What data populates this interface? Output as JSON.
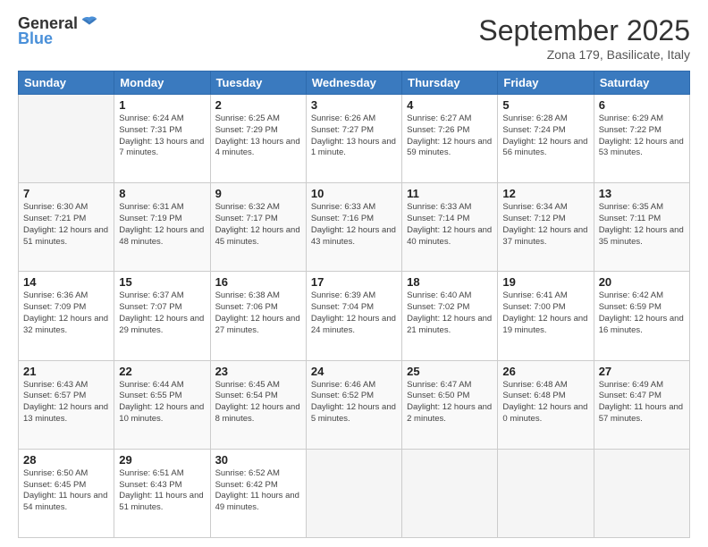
{
  "header": {
    "logo_general": "General",
    "logo_blue": "Blue",
    "month_title": "September 2025",
    "subtitle": "Zona 179, Basilicate, Italy"
  },
  "weekdays": [
    "Sunday",
    "Monday",
    "Tuesday",
    "Wednesday",
    "Thursday",
    "Friday",
    "Saturday"
  ],
  "weeks": [
    [
      {
        "day": "",
        "info": ""
      },
      {
        "day": "1",
        "info": "Sunrise: 6:24 AM\nSunset: 7:31 PM\nDaylight: 13 hours\nand 7 minutes."
      },
      {
        "day": "2",
        "info": "Sunrise: 6:25 AM\nSunset: 7:29 PM\nDaylight: 13 hours\nand 4 minutes."
      },
      {
        "day": "3",
        "info": "Sunrise: 6:26 AM\nSunset: 7:27 PM\nDaylight: 13 hours\nand 1 minute."
      },
      {
        "day": "4",
        "info": "Sunrise: 6:27 AM\nSunset: 7:26 PM\nDaylight: 12 hours\nand 59 minutes."
      },
      {
        "day": "5",
        "info": "Sunrise: 6:28 AM\nSunset: 7:24 PM\nDaylight: 12 hours\nand 56 minutes."
      },
      {
        "day": "6",
        "info": "Sunrise: 6:29 AM\nSunset: 7:22 PM\nDaylight: 12 hours\nand 53 minutes."
      }
    ],
    [
      {
        "day": "7",
        "info": "Sunrise: 6:30 AM\nSunset: 7:21 PM\nDaylight: 12 hours\nand 51 minutes."
      },
      {
        "day": "8",
        "info": "Sunrise: 6:31 AM\nSunset: 7:19 PM\nDaylight: 12 hours\nand 48 minutes."
      },
      {
        "day": "9",
        "info": "Sunrise: 6:32 AM\nSunset: 7:17 PM\nDaylight: 12 hours\nand 45 minutes."
      },
      {
        "day": "10",
        "info": "Sunrise: 6:33 AM\nSunset: 7:16 PM\nDaylight: 12 hours\nand 43 minutes."
      },
      {
        "day": "11",
        "info": "Sunrise: 6:33 AM\nSunset: 7:14 PM\nDaylight: 12 hours\nand 40 minutes."
      },
      {
        "day": "12",
        "info": "Sunrise: 6:34 AM\nSunset: 7:12 PM\nDaylight: 12 hours\nand 37 minutes."
      },
      {
        "day": "13",
        "info": "Sunrise: 6:35 AM\nSunset: 7:11 PM\nDaylight: 12 hours\nand 35 minutes."
      }
    ],
    [
      {
        "day": "14",
        "info": "Sunrise: 6:36 AM\nSunset: 7:09 PM\nDaylight: 12 hours\nand 32 minutes."
      },
      {
        "day": "15",
        "info": "Sunrise: 6:37 AM\nSunset: 7:07 PM\nDaylight: 12 hours\nand 29 minutes."
      },
      {
        "day": "16",
        "info": "Sunrise: 6:38 AM\nSunset: 7:06 PM\nDaylight: 12 hours\nand 27 minutes."
      },
      {
        "day": "17",
        "info": "Sunrise: 6:39 AM\nSunset: 7:04 PM\nDaylight: 12 hours\nand 24 minutes."
      },
      {
        "day": "18",
        "info": "Sunrise: 6:40 AM\nSunset: 7:02 PM\nDaylight: 12 hours\nand 21 minutes."
      },
      {
        "day": "19",
        "info": "Sunrise: 6:41 AM\nSunset: 7:00 PM\nDaylight: 12 hours\nand 19 minutes."
      },
      {
        "day": "20",
        "info": "Sunrise: 6:42 AM\nSunset: 6:59 PM\nDaylight: 12 hours\nand 16 minutes."
      }
    ],
    [
      {
        "day": "21",
        "info": "Sunrise: 6:43 AM\nSunset: 6:57 PM\nDaylight: 12 hours\nand 13 minutes."
      },
      {
        "day": "22",
        "info": "Sunrise: 6:44 AM\nSunset: 6:55 PM\nDaylight: 12 hours\nand 10 minutes."
      },
      {
        "day": "23",
        "info": "Sunrise: 6:45 AM\nSunset: 6:54 PM\nDaylight: 12 hours\nand 8 minutes."
      },
      {
        "day": "24",
        "info": "Sunrise: 6:46 AM\nSunset: 6:52 PM\nDaylight: 12 hours\nand 5 minutes."
      },
      {
        "day": "25",
        "info": "Sunrise: 6:47 AM\nSunset: 6:50 PM\nDaylight: 12 hours\nand 2 minutes."
      },
      {
        "day": "26",
        "info": "Sunrise: 6:48 AM\nSunset: 6:48 PM\nDaylight: 12 hours\nand 0 minutes."
      },
      {
        "day": "27",
        "info": "Sunrise: 6:49 AM\nSunset: 6:47 PM\nDaylight: 11 hours\nand 57 minutes."
      }
    ],
    [
      {
        "day": "28",
        "info": "Sunrise: 6:50 AM\nSunset: 6:45 PM\nDaylight: 11 hours\nand 54 minutes."
      },
      {
        "day": "29",
        "info": "Sunrise: 6:51 AM\nSunset: 6:43 PM\nDaylight: 11 hours\nand 51 minutes."
      },
      {
        "day": "30",
        "info": "Sunrise: 6:52 AM\nSunset: 6:42 PM\nDaylight: 11 hours\nand 49 minutes."
      },
      {
        "day": "",
        "info": ""
      },
      {
        "day": "",
        "info": ""
      },
      {
        "day": "",
        "info": ""
      },
      {
        "day": "",
        "info": ""
      }
    ]
  ]
}
